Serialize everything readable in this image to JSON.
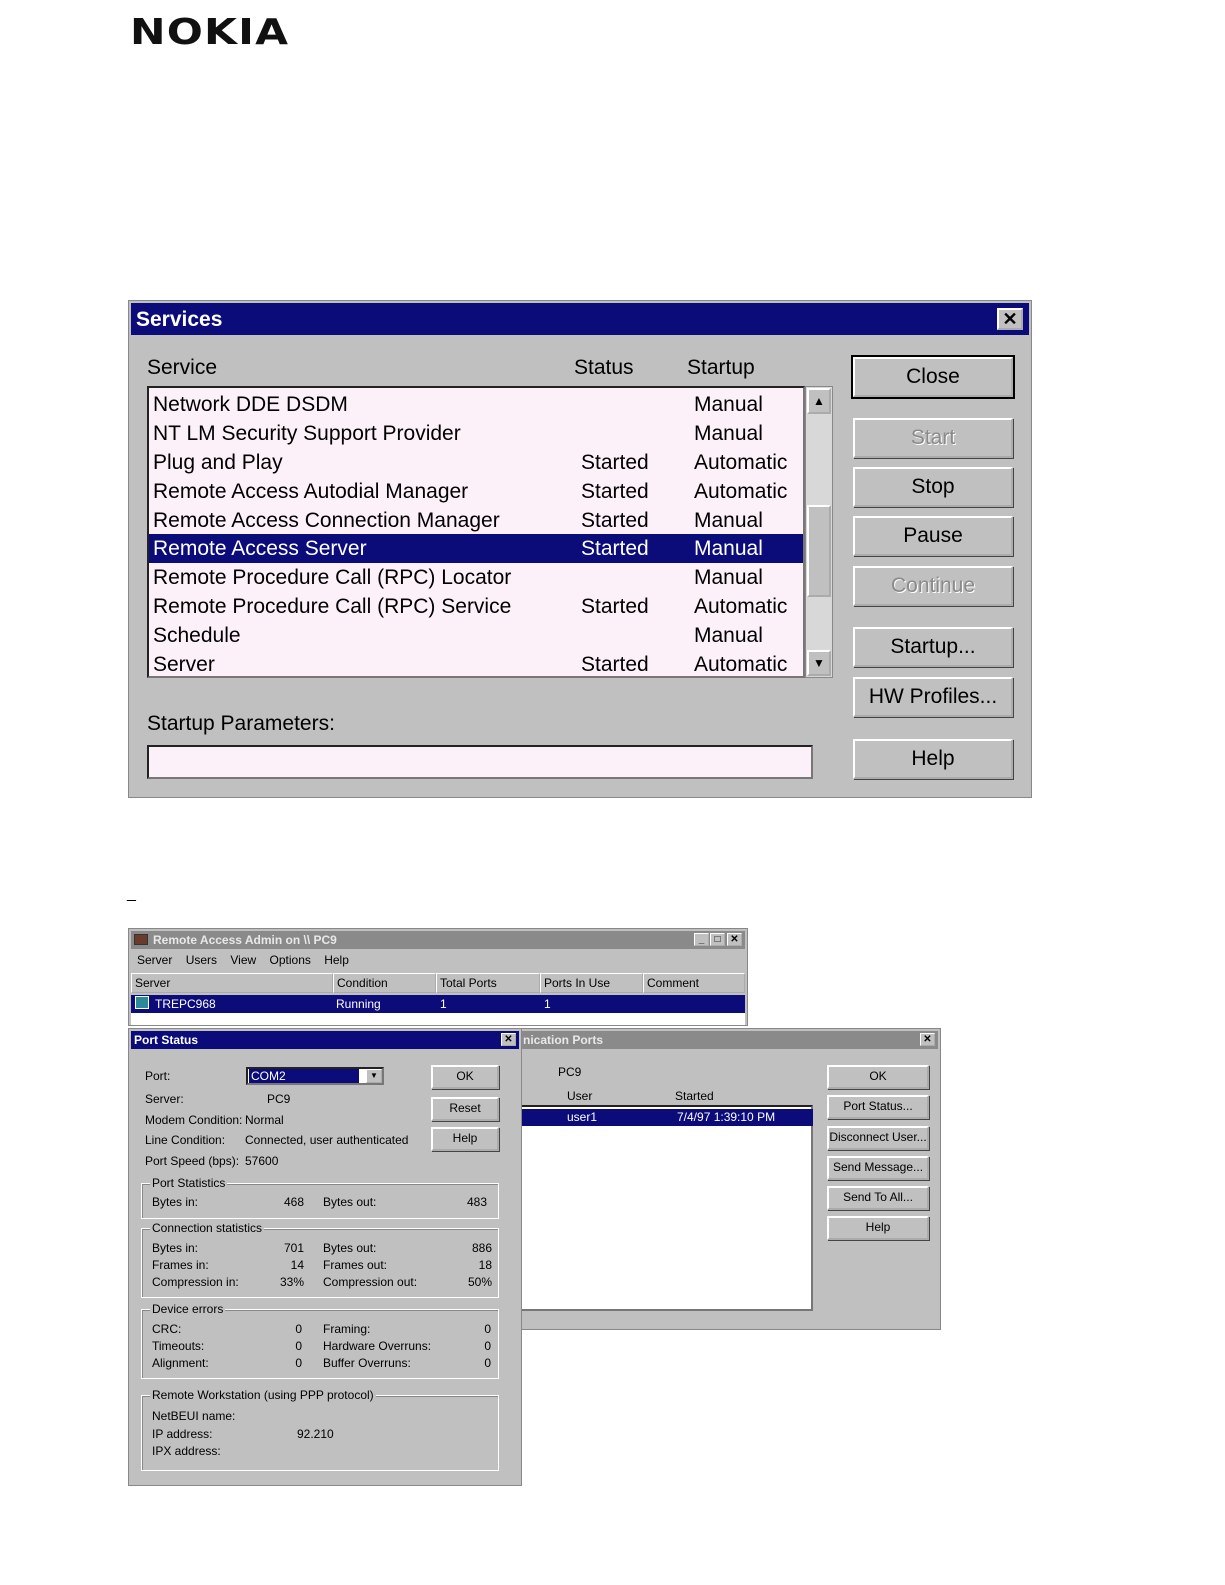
{
  "logo": "NOKIA",
  "services": {
    "title": "Services",
    "close_x": "✕",
    "columns": {
      "service": "Service",
      "status": "Status",
      "startup": "Startup"
    },
    "rows": [
      {
        "name": "Network DDE DSDM",
        "status": "",
        "startup": "Manual"
      },
      {
        "name": "NT LM Security Support Provider",
        "status": "",
        "startup": "Manual"
      },
      {
        "name": "Plug and Play",
        "status": "Started",
        "startup": "Automatic"
      },
      {
        "name": "Remote Access Autodial Manager",
        "status": "Started",
        "startup": "Automatic"
      },
      {
        "name": "Remote Access Connection Manager",
        "status": "Started",
        "startup": "Manual"
      },
      {
        "name": "Remote Access Server",
        "status": "Started",
        "startup": "Manual"
      },
      {
        "name": "Remote Procedure Call (RPC) Locator",
        "status": "",
        "startup": "Manual"
      },
      {
        "name": "Remote Procedure Call (RPC) Service",
        "status": "Started",
        "startup": "Automatic"
      },
      {
        "name": "Schedule",
        "status": "",
        "startup": "Manual"
      },
      {
        "name": "Server",
        "status": "Started",
        "startup": "Automatic"
      }
    ],
    "selected_row": "Remote Access Server",
    "buttons": {
      "close": "Close",
      "start": "Start",
      "stop": "Stop",
      "pause": "Pause",
      "continue": "Continue",
      "startup": "Startup...",
      "hw_profiles": "HW Profiles...",
      "help": "Help"
    },
    "startup_params_label": "Startup Parameters:",
    "startup_params_value": ""
  },
  "ras_admin": {
    "title": "Remote Access Admin on \\\\        PC9",
    "menu": [
      "Server",
      "Users",
      "View",
      "Options",
      "Help"
    ],
    "columns": [
      "Server",
      "Condition",
      "Total Ports",
      "Ports In Use",
      "Comment"
    ],
    "row": {
      "server": "TREPC968",
      "condition": "Running",
      "total_ports": "1",
      "ports_in_use": "1",
      "comment": ""
    }
  },
  "comm_ports": {
    "title": "nication Ports",
    "server": "PC9",
    "columns": {
      "user": "User",
      "started": "Started"
    },
    "row": {
      "user": "user1",
      "started": "7/4/97 1:39:10 PM"
    },
    "buttons": [
      "OK",
      "Port Status...",
      "Disconnect User...",
      "Send Message...",
      "Send To All...",
      "Help"
    ]
  },
  "port_status": {
    "title": "Port Status",
    "port_label": "Port:",
    "port_value": "COM2",
    "server_label": "Server:",
    "server_value": "PC9",
    "modem_label": "Modem Condition:",
    "modem_value": "Normal",
    "line_label": "Line Condition:",
    "line_value": "Connected, user authenticated",
    "speed_label": "Port Speed (bps):",
    "speed_value": "57600",
    "buttons": {
      "ok": "OK",
      "reset": "Reset",
      "help": "Help"
    },
    "port_statistics": {
      "legend": "Port Statistics",
      "bytes_in_label": "Bytes in:",
      "bytes_in": "468",
      "bytes_out_label": "Bytes out:",
      "bytes_out": "483"
    },
    "connection_statistics": {
      "legend": "Connection statistics",
      "bytes_in_label": "Bytes in:",
      "bytes_in": "701",
      "bytes_out_label": "Bytes out:",
      "bytes_out": "886",
      "frames_in_label": "Frames in:",
      "frames_in": "14",
      "frames_out_label": "Frames out:",
      "frames_out": "18",
      "comp_in_label": "Compression in:",
      "comp_in": "33%",
      "comp_out_label": "Compression out:",
      "comp_out": "50%"
    },
    "device_errors": {
      "legend": "Device errors",
      "crc_label": "CRC:",
      "crc": "0",
      "framing_label": "Framing:",
      "framing": "0",
      "timeouts_label": "Timeouts:",
      "timeouts": "0",
      "hw_overruns_label": "Hardware Overruns:",
      "hw_overruns": "0",
      "alignment_label": "Alignment:",
      "alignment": "0",
      "buf_overruns_label": "Buffer Overruns:",
      "buf_overruns": "0"
    },
    "remote_workstation": {
      "legend": "Remote Workstation (using PPP protocol)",
      "netbeui_label": "NetBEUI name:",
      "netbeui": "",
      "ip_label": "IP address:",
      "ip": "92.210",
      "ipx_label": "IPX address:",
      "ipx": ""
    }
  },
  "footnote_mark": "_"
}
